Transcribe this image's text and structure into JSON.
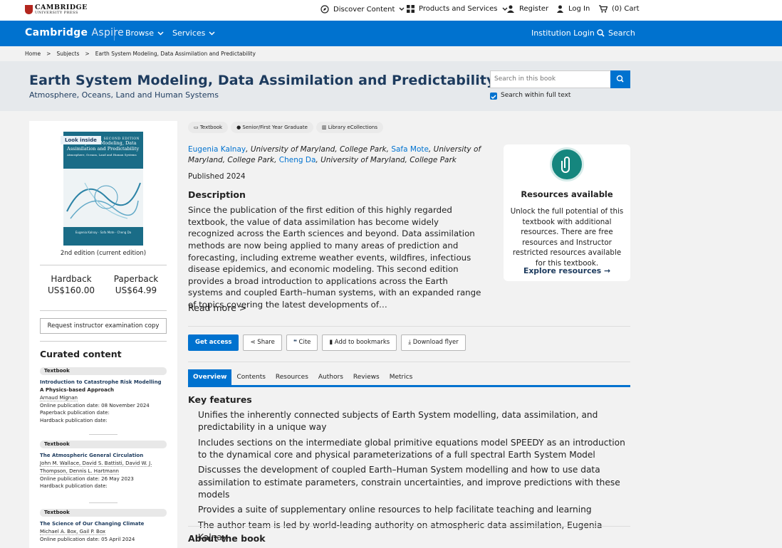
{
  "colors": {
    "brand_blue": "#0072cf",
    "title_navy": "#1d3b5e",
    "resources_teal": "#15867e"
  },
  "top": {
    "logo_main": "CAMBRIDGE",
    "logo_sub": "UNIVERSITY PRESS",
    "discover": "Discover Content",
    "products": "Products and Services",
    "register": "Register",
    "login": "Log In",
    "cart": "(0) Cart"
  },
  "nav": {
    "brand_a": "Cambridge",
    "brand_b": "Aspire",
    "browse": "Browse",
    "services": "Services",
    "institution": "Institution Login",
    "search": "Search"
  },
  "breadcrumb": [
    "Home",
    "Subjects",
    "Earth System Modeling, Data Assimilation and Predictability"
  ],
  "breadcrumb_sep": ">",
  "book": {
    "title": "Earth System Modeling, Data Assimilation and Predictability",
    "subtitle": "Atmosphere, Oceans, Land and Human Systems",
    "search_placeholder": "Search in this book",
    "search_within": "Search within full text",
    "look_inside": "Look inside",
    "cover_title": "Earth System Modeling, Data Assimilation and Predictability",
    "cover_sub": "Atmosphere, Oceans, Land and Human Systems",
    "cover_edition": "SECOND EDITION",
    "cover_authors": "Eugenia Kalnay · Safa Mote · Cheng Da",
    "edition": "2nd edition (current edition)",
    "hardback_label": "Hardback",
    "hardback_price": "US$160.00",
    "paperback_label": "Paperback",
    "paperback_price": "US$64.99",
    "request_copy": "Request instructor examination copy"
  },
  "chips": [
    "Textbook",
    "Senior/First Year Graduate",
    "Library eCollections"
  ],
  "authors": {
    "a1": "Eugenia Kalnay",
    "a1_aff": "University of Maryland, College Park",
    "a2": "Safa Mote",
    "a2_aff": "University of Maryland, College Park",
    "a3": "Cheng Da",
    "a3_aff": "University of Maryland, College Park"
  },
  "published": "Published 2024",
  "description_heading": "Description",
  "description": "Since the publication of the first edition of this highly regarded textbook, the value of data assimilation has become widely recognized across the Earth sciences and beyond. Data assimilation methods are now being applied to many areas of prediction and forecasting, including extreme weather events, wildfires, infectious disease epidemics, and economic modeling. This second edition provides a broad introduction to applications across the Earth systems and coupled Earth–human systems, with an expanded range of topics covering the latest developments of…",
  "read_more": "Read more >",
  "resources": {
    "title": "Resources available",
    "text": "Unlock the full potential of this textbook with additional resources. There are free resources and Instructor restricted resources available for this textbook.",
    "explore": "Explore resources"
  },
  "actions": {
    "get_access": "Get access",
    "share": "Share",
    "cite": "Cite",
    "bookmark": "Add to bookmarks",
    "flyer": "Download flyer"
  },
  "tabs": [
    "Overview",
    "Contents",
    "Resources",
    "Authors",
    "Reviews",
    "Metrics"
  ],
  "key_features_heading": "Key features",
  "features": [
    "Unifies the inherently connected subjects of Earth System modelling, data assimilation, and predictability in a unique way",
    "Includes sections on the intermediate global primitive equations model SPEEDY as an introduction to the dynamical core and physical parameterizations of a full spectral Earth System Model",
    "Discusses the development of coupled Earth–Human System modelling and how to use data assimilation to estimate parameters, constrain uncertainties, and improve predictions with these models",
    "Provides a suite of supplementary online resources to help facilitate teaching and learning",
    "The author team is led by world-leading authority on atmospheric data assimilation, Eugenia Kalnay"
  ],
  "about_heading": "About the book",
  "curated": {
    "heading": "Curated content",
    "items": [
      {
        "type": "Textbook",
        "title": "Introduction to Catastrophe Risk Modelling",
        "subtitle": "A Physics-based Approach",
        "authors": "Arnaud Mignan",
        "l1": "Online publication date: 08 November 2024",
        "l2": "Paperback publication date:",
        "l3": "Hardback publication date:"
      },
      {
        "type": "Textbook",
        "title": "The Atmospheric General Circulation",
        "authors": "John M. Wallace, David S. Battisti, David W. J. Thompson, Dennis L. Hartmann",
        "l1": "Online publication date: 26 May 2023",
        "l2": "Hardback publication date:"
      },
      {
        "type": "Textbook",
        "title": "The Science of Our Changing Climate",
        "authors": "Michael A. Box, Gail P. Box",
        "l1": "Online publication date: 05 April 2024"
      }
    ]
  }
}
